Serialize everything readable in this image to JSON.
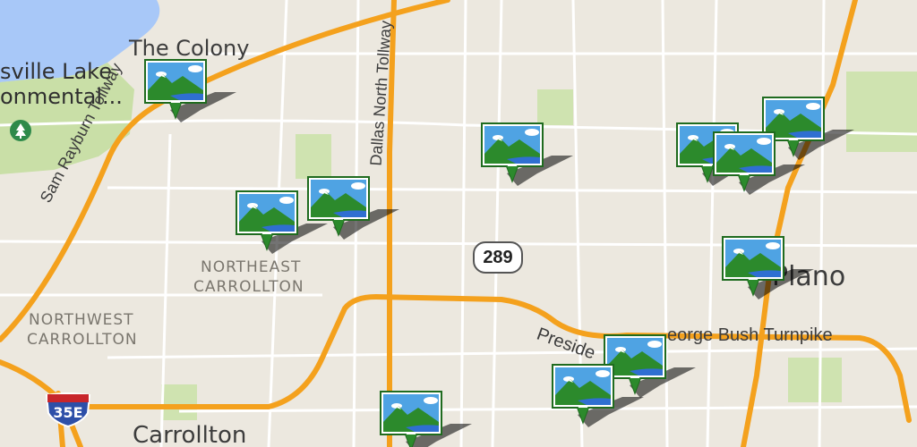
{
  "map": {
    "places": {
      "the_colony": "The Colony",
      "lake_line1": "sville Lake",
      "lake_line2": "onmental...",
      "carrollton": "Carrollton",
      "plano": "Plano"
    },
    "districts": {
      "northeast_carrollton_1": "NORTHEAST",
      "northeast_carrollton_2": "CARROLLTON",
      "northwest_carrollton_1": "NORTHWEST",
      "northwest_carrollton_2": "CARROLLTON"
    },
    "roads": {
      "sam_rayburn": "Sam Rayburn Tollway",
      "dallas_north": "Dallas North Tollway",
      "george_bush_left": "Preside",
      "george_bush_right": "eorge Bush Turnpike"
    },
    "shields": {
      "state_highway": "289",
      "interstate": "35E"
    },
    "icons": {
      "park": "tree-icon",
      "marker": "landscape-photo-marker-icon"
    },
    "colors": {
      "land": "#ece8df",
      "water": "#a8c8f8",
      "park": "#c9dfa7",
      "highway": "#f4a11d",
      "street": "#ffffff",
      "marker_sky": "#4fa3e3",
      "marker_hill": "#2c8a2c",
      "marker_border": "#1f6b1f"
    }
  }
}
